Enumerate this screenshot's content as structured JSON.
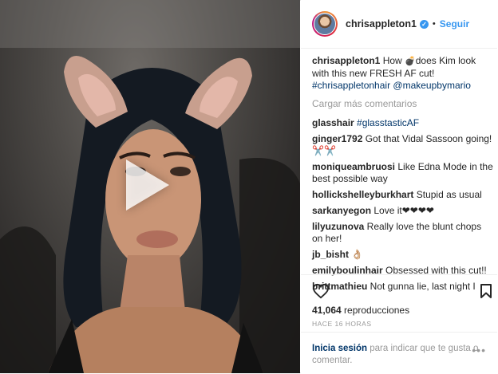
{
  "post": {
    "username": "chrisappleton1",
    "verified_glyph": "✓",
    "separator": "•",
    "follow_label": "Seguir"
  },
  "caption": {
    "user": "chrisappleton1",
    "text_part1": " How ",
    "emoji": "💣",
    "text_part2": "does Kim look with this new FRESH AF cut!",
    "hashtag": "#chrisappletonhair",
    "mention": "@makeupbymario"
  },
  "load_more_label": "Cargar más comentarios",
  "comments": [
    {
      "user": "glasshair",
      "text": " #glasstasticAF",
      "is_tag": true
    },
    {
      "user": "ginger1792",
      "text": " Got that Vidal Sassoon going! ✂️✂️"
    },
    {
      "user": "moniqueambruosi",
      "text": " Like Edna Mode in the best possible way"
    },
    {
      "user": "hollickshelleyburkhart",
      "text": " Stupid as usual"
    },
    {
      "user": "sarkanyegon",
      "text": " Love it❤❤❤❤"
    },
    {
      "user": "lilyuzunova",
      "text": " Really love the blunt chops on her!"
    },
    {
      "user": "jb_bisht",
      "text": " 👌🏼"
    },
    {
      "user": "emilyboulinhair",
      "text": " Obsessed with this cut!!"
    },
    {
      "user": "brittmathieu",
      "text": " Not gunna lie, last night I"
    }
  ],
  "stats": {
    "views_count": "41,064",
    "views_label": " reproducciones",
    "time_ago": "HACE 16 HORAS"
  },
  "login": {
    "link_label": "Inicia sesión",
    "rest_text": " para indicar que te gusta o comentar.",
    "more_label": "•••"
  },
  "icons": {
    "play": "play-icon",
    "like": "heart-icon",
    "save": "bookmark-icon"
  }
}
